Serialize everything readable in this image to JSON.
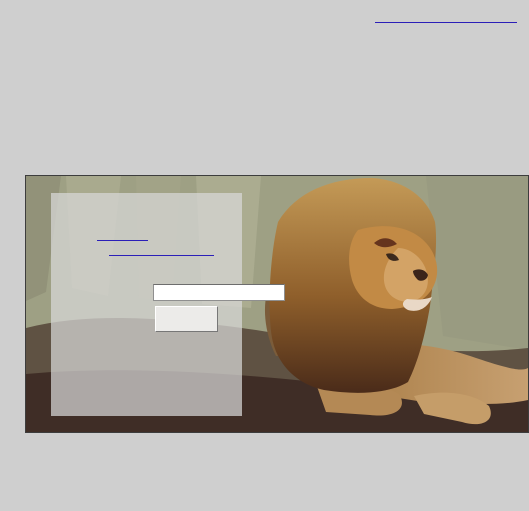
{
  "header": {
    "top_link_label": ""
  },
  "scene": {
    "image_alt": "lion-photo",
    "colors": {
      "grass": "#a9ab8e",
      "mane": "#9b6a2b",
      "body": "#b1864e",
      "ground": "#3d2d26"
    }
  },
  "panel": {
    "link_1": "",
    "link_2": "",
    "input_value": "",
    "input_placeholder": "",
    "button_label": ""
  }
}
